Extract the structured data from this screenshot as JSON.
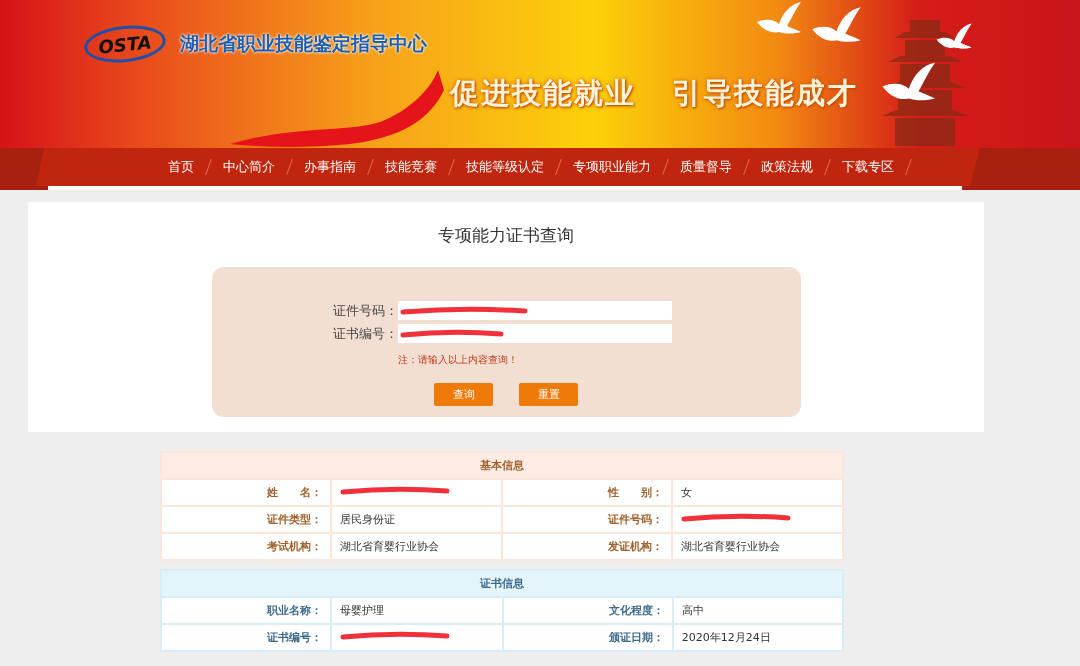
{
  "header": {
    "logo": "OSTA",
    "site_title": "湖北省职业技能鉴定指导中心",
    "slogans": [
      "促进技能就业",
      "引导技能成才"
    ]
  },
  "nav": {
    "items": [
      {
        "label": "首页"
      },
      {
        "label": "中心简介"
      },
      {
        "label": "办事指南"
      },
      {
        "label": "技能竞赛"
      },
      {
        "label": "技能等级认定"
      },
      {
        "label": "专项职业能力"
      },
      {
        "label": "质量督导"
      },
      {
        "label": "政策法规"
      },
      {
        "label": "下载专区"
      }
    ]
  },
  "query": {
    "title": "专项能力证书查询",
    "fields": [
      {
        "label": "证件号码：",
        "redacted": true
      },
      {
        "label": "证书编号：",
        "redacted": true
      }
    ],
    "note": "注：请输入以上内容查询！",
    "buttons": [
      "查询",
      "重置"
    ]
  },
  "sections": [
    {
      "title": "基本信息",
      "rows": [
        [
          {
            "label": "姓　　名：",
            "redacted": true
          },
          {
            "label": "性　　别：",
            "value": "女"
          }
        ],
        [
          {
            "label": "证件类型：",
            "value": "居民身份证"
          },
          {
            "label": "证件号码：",
            "redacted": true
          }
        ],
        [
          {
            "label": "考试机构：",
            "value": "湖北省育婴行业协会"
          },
          {
            "label": "发证机构：",
            "value": "湖北省育婴行业协会"
          }
        ]
      ]
    },
    {
      "title": "证书信息",
      "rows": [
        [
          {
            "label": "职业名称：",
            "value": "母婴护理"
          },
          {
            "label": "文化程度：",
            "value": "高中"
          }
        ],
        [
          {
            "label": "证书编号：",
            "redacted": true
          },
          {
            "label": "颁证日期：",
            "value": "2020年12月24日"
          }
        ]
      ]
    }
  ]
}
